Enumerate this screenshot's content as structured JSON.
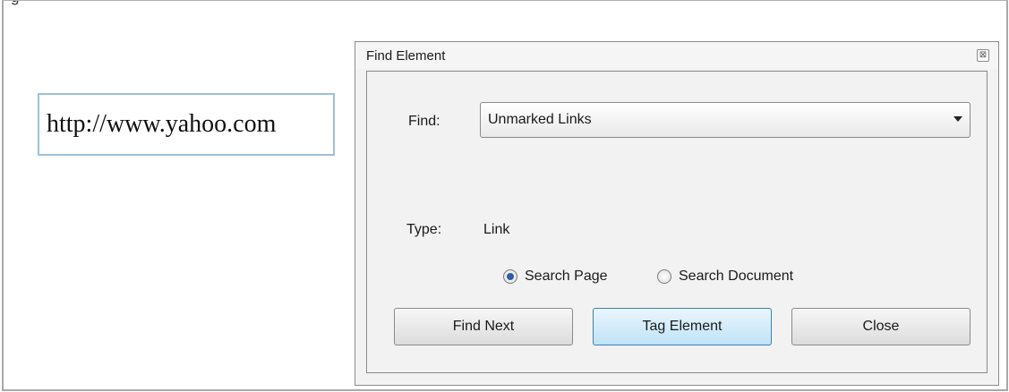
{
  "page": {
    "top_text_clipped": "g",
    "link_text": "http://www.yahoo.com"
  },
  "dialog": {
    "title": "Find Element",
    "close_glyph": "⊠",
    "find_label": "Find:",
    "find_value": "Unmarked Links",
    "type_label": "Type:",
    "type_value": "Link",
    "radio": [
      {
        "label": "Search Page",
        "checked": true
      },
      {
        "label": "Search Document",
        "checked": false
      }
    ],
    "buttons": {
      "find_next": "Find Next",
      "tag_element": "Tag Element",
      "close": "Close"
    }
  },
  "colors": {
    "primary_button": "#bfe3f7",
    "link_border": "#9ec0d9",
    "radio_selected": "#2a5fa8"
  }
}
